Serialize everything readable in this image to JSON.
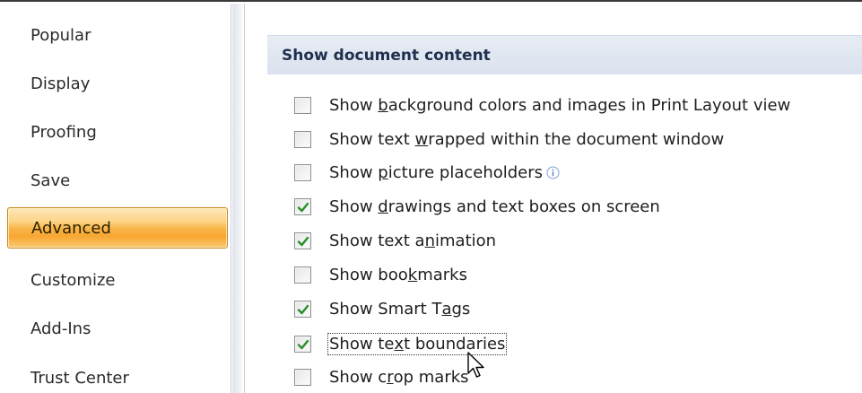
{
  "sidebar": {
    "items": [
      {
        "label": "Popular"
      },
      {
        "label": "Display"
      },
      {
        "label": "Proofing"
      },
      {
        "label": "Save"
      },
      {
        "label": "Advanced",
        "selected": true
      },
      {
        "label": "Customize"
      },
      {
        "label": "Add-Ins"
      },
      {
        "label": "Trust Center"
      }
    ]
  },
  "section": {
    "title": "Show document content",
    "options": [
      {
        "pre": "Show ",
        "key": "b",
        "post": "ackground colors and images in Print Layout view",
        "checked": false
      },
      {
        "pre": "Show text ",
        "key": "w",
        "post": "rapped within the document window",
        "checked": false
      },
      {
        "pre": "Show ",
        "key": "p",
        "post": "icture placeholders",
        "checked": false,
        "info_icon": "info-icon"
      },
      {
        "pre": "Show ",
        "key": "d",
        "post": "rawings and text boxes on screen",
        "checked": true
      },
      {
        "pre": "Show text a",
        "key": "n",
        "post": "imation",
        "checked": true
      },
      {
        "pre": "Show boo",
        "key": "k",
        "post": "marks",
        "checked": false
      },
      {
        "pre": "Show Smart T",
        "key": "a",
        "post": "gs",
        "checked": true
      },
      {
        "pre": "Show te",
        "key": "x",
        "post": "t boundaries",
        "checked": true,
        "focused": true
      },
      {
        "pre": "Show c",
        "key": "r",
        "post": "op marks",
        "checked": false
      }
    ]
  },
  "colors": {
    "selected_nav": "#f9b548",
    "section_header_bg": "#dbe2ee",
    "checkmark": "#2a8f2a"
  },
  "cursor": {
    "icon": "mouse-pointer-icon"
  }
}
